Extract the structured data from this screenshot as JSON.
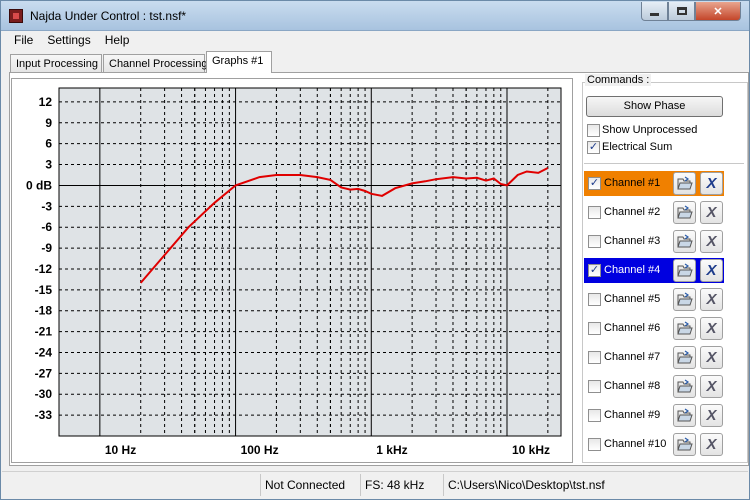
{
  "window": {
    "title": "Najda Under Control : tst.nsf*",
    "close_glyph": "✕"
  },
  "menu": {
    "file": "File",
    "settings": "Settings",
    "help": "Help"
  },
  "tabs": [
    {
      "label": "Input Processing"
    },
    {
      "label": "Channel Processing"
    },
    {
      "label": "Graphs #1",
      "active": true
    }
  ],
  "graph": {
    "y_ticks": [
      "12",
      "9",
      "6",
      "3",
      "0 dB",
      "-3",
      "-6",
      "-9",
      "-12",
      "-15",
      "-18",
      "-21",
      "-24",
      "-27",
      "-30",
      "-33"
    ],
    "x_labels": [
      "10 Hz",
      "100 Hz",
      "1 kHz",
      "10 kHz"
    ],
    "curve_color": "#e00000"
  },
  "chart_data": {
    "type": "line",
    "x_scale": "log",
    "xlim": [
      5,
      25000
    ],
    "ylim": [
      -36,
      14
    ],
    "series": [
      {
        "color": "#e00000",
        "x": [
          20,
          30,
          45,
          70,
          100,
          150,
          200,
          300,
          400,
          500,
          600,
          700,
          800,
          900,
          1000,
          1200,
          1500,
          2000,
          2500,
          3000,
          4000,
          5000,
          6000,
          7000,
          8000,
          9000,
          10000,
          12000,
          14000,
          17000,
          20000
        ],
        "y": [
          -14,
          -10,
          -6,
          -2.5,
          0,
          1.2,
          1.5,
          1.5,
          1.2,
          0.8,
          -0.3,
          -0.6,
          -0.5,
          -0.8,
          -1.2,
          -1.5,
          -0.4,
          0.3,
          0.6,
          0.9,
          1.2,
          1.0,
          1.1,
          0.7,
          1.0,
          0.2,
          0.0,
          1.5,
          2.0,
          1.8,
          2.5
        ]
      }
    ]
  },
  "commands": {
    "label": "Commands :",
    "show_phase": "Show Phase",
    "show_unprocessed": "Show Unprocessed",
    "show_unprocessed_checked": false,
    "electrical_sum": "Electrical Sum",
    "electrical_sum_checked": true
  },
  "channels": [
    {
      "label": "Channel #1",
      "checked": true,
      "highlight": "#f08000"
    },
    {
      "label": "Channel #2",
      "checked": false,
      "highlight": ""
    },
    {
      "label": "Channel #3",
      "checked": false,
      "highlight": ""
    },
    {
      "label": "Channel #4",
      "checked": true,
      "highlight": "#0000e0"
    },
    {
      "label": "Channel #5",
      "checked": false,
      "highlight": ""
    },
    {
      "label": "Channel #6",
      "checked": false,
      "highlight": ""
    },
    {
      "label": "Channel #7",
      "checked": false,
      "highlight": ""
    },
    {
      "label": "Channel #8",
      "checked": false,
      "highlight": ""
    },
    {
      "label": "Channel #9",
      "checked": false,
      "highlight": ""
    },
    {
      "label": "Channel #10",
      "checked": false,
      "highlight": ""
    }
  ],
  "status": {
    "connection": "Not Connected",
    "fs": "FS: 48 kHz",
    "path": "C:\\Users\\Nico\\Desktop\\tst.nsf"
  },
  "checkmark_glyph": "✓",
  "delete_glyph": "X"
}
